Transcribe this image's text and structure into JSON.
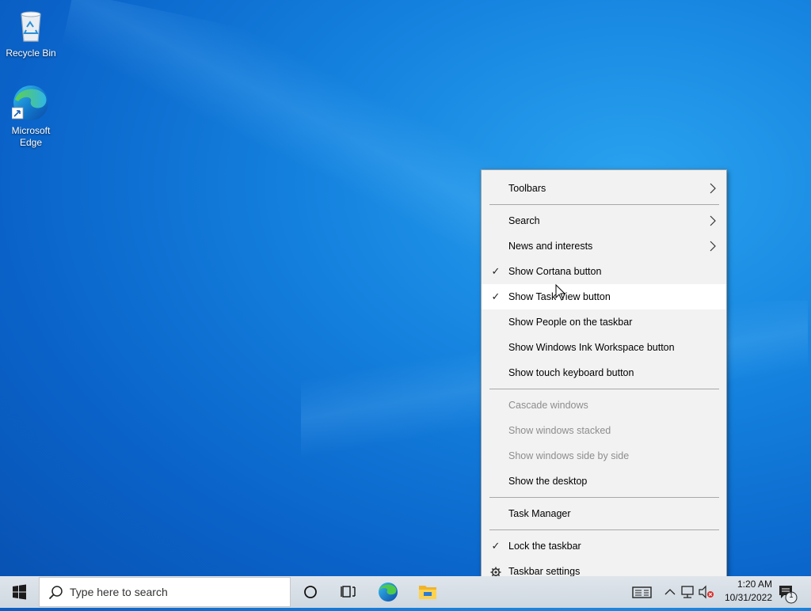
{
  "desktop": {
    "icons": [
      {
        "label": "Recycle Bin",
        "icon": "recycle-bin-icon"
      },
      {
        "label": "Microsoft Edge",
        "icon": "edge-icon"
      }
    ]
  },
  "context_menu": {
    "items": [
      {
        "label": "Toolbars",
        "submenu": true
      },
      {
        "label": "Search",
        "submenu": true
      },
      {
        "label": "News and interests",
        "submenu": true
      },
      {
        "label": "Show Cortana button",
        "checked": true
      },
      {
        "label": "Show Task View button",
        "checked": true,
        "hovered": true
      },
      {
        "label": "Show People on the taskbar"
      },
      {
        "label": "Show Windows Ink Workspace button"
      },
      {
        "label": "Show touch keyboard button"
      },
      {
        "label": "Cascade windows",
        "disabled": true
      },
      {
        "label": "Show windows stacked",
        "disabled": true
      },
      {
        "label": "Show windows side by side",
        "disabled": true
      },
      {
        "label": "Show the desktop"
      },
      {
        "label": "Task Manager"
      },
      {
        "label": "Lock the taskbar",
        "checked": true
      },
      {
        "label": "Taskbar settings",
        "icon": "gear-icon"
      }
    ]
  },
  "taskbar": {
    "search_placeholder": "Type here to search",
    "time": "1:20 AM",
    "date": "10/31/2022",
    "notification_count": "1"
  },
  "colors": {
    "accent": "#0078d7",
    "menu_background": "#f2f2f2",
    "taskbar_background": "#d4dde6"
  }
}
